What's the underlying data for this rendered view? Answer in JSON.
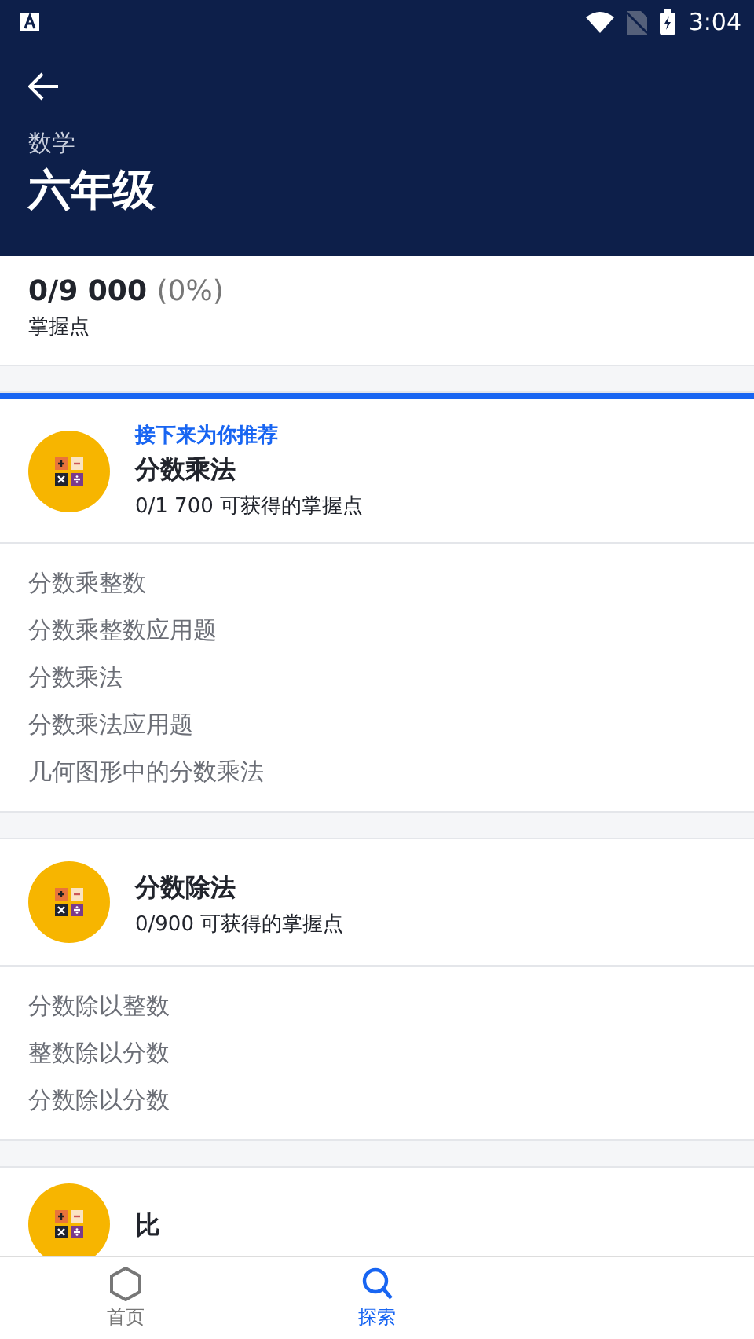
{
  "status_bar": {
    "time": "3:04"
  },
  "header": {
    "subject": "数学",
    "title": "六年级"
  },
  "mastery": {
    "points": "0/9 000",
    "percent": "(0%)",
    "label": "掌握点"
  },
  "units": [
    {
      "recommended_label": "接下来为你推荐",
      "title": "分数乘法",
      "points": "0/1 700 可获得的掌握点",
      "topics": [
        "分数乘整数",
        "分数乘整数应用题",
        "分数乘法",
        "分数乘法应用题",
        "几何图形中的分数乘法"
      ]
    },
    {
      "title": "分数除法",
      "points": "0/900 可获得的掌握点",
      "topics": [
        "分数除以整数",
        "整数除以分数",
        "分数除以分数"
      ]
    },
    {
      "title": "比"
    }
  ],
  "bottom_nav": [
    {
      "label": "首页",
      "kind": "home",
      "selected": false
    },
    {
      "label": "探索",
      "kind": "search",
      "selected": true
    }
  ]
}
